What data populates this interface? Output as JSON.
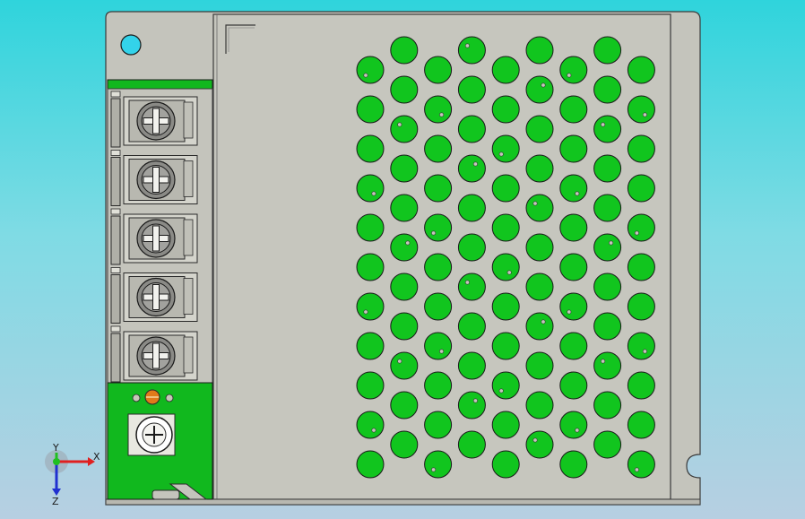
{
  "viewport": {
    "background_top": "#2fd4dc",
    "background_bottom": "#b7cfe2"
  },
  "model": {
    "body_color": "#c4c4bc",
    "edge_color": "#3a3a3a",
    "pcb_color": "#11b81e",
    "vent_hole_color": "#11c51e",
    "mount_hole_color": "#33d3ea",
    "terminal_count": 5,
    "vent_rows": 12,
    "vent_columns": 9
  },
  "triad": {
    "x_label": "X",
    "y_label": "Y",
    "z_label": "Z",
    "x_color": "#e02020",
    "y_color": "#20c020",
    "z_color": "#2030d0"
  }
}
